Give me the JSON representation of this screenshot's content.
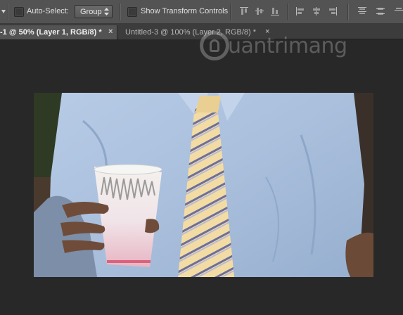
{
  "options_bar": {
    "auto_select_label": "Auto-Select:",
    "auto_select_checked": false,
    "auto_select_target": "Group",
    "show_transform_label": "Show Transform Controls",
    "show_transform_checked": false,
    "align_icons": [
      "align-top-edges-icon",
      "align-vertical-centers-icon",
      "align-bottom-edges-icon",
      "align-left-edges-icon",
      "align-horizontal-centers-icon",
      "align-right-edges-icon",
      "distribute-top-edges-icon",
      "distribute-vertical-centers-icon"
    ]
  },
  "tabs": [
    {
      "label": "-1 @ 50% (Layer 1, RGB/8) *",
      "close": "×",
      "active": true
    },
    {
      "label": "Untitled-3 @ 100% (Layer 2, RGB/8) *",
      "close": "×",
      "active": false
    }
  ],
  "watermark": {
    "text": "uantrimang"
  },
  "canvas": {
    "image": "man in blue shirt and striped yellow tie holding paper cup"
  },
  "colors": {
    "options_bg": "#535353",
    "workspace_bg": "#282828",
    "tab_active": "#535353",
    "tab_inactive": "#3c3c3c"
  }
}
